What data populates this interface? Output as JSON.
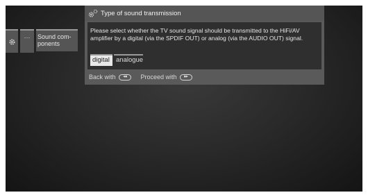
{
  "menu": {
    "gear_icon": "gear-icon",
    "dots_label": "···",
    "item_label_line1": "Sound com-",
    "item_label_line2": "ponents"
  },
  "dialog": {
    "title": "Type of sound transmission",
    "title_icon": "gears-icon",
    "text_line1": "Please select whether the TV sound signal should be transmitted to the HiFi/AV",
    "text_line2": "amplifier by a digital (via the SPDIF OUT) or analog (via the AUDIO OUT) signal.",
    "options": [
      {
        "label": "digital",
        "selected": true
      },
      {
        "label": "analogue",
        "selected": false
      }
    ]
  },
  "footer": {
    "back_label": "Back with",
    "back_key_glyph": "◂◂",
    "proceed_label": "Proceed with",
    "proceed_key_glyph": "▸▸"
  },
  "colors": {
    "panel": "#5a5a5a",
    "body": "#2f2f2f",
    "selected": "#e8e8e8"
  }
}
